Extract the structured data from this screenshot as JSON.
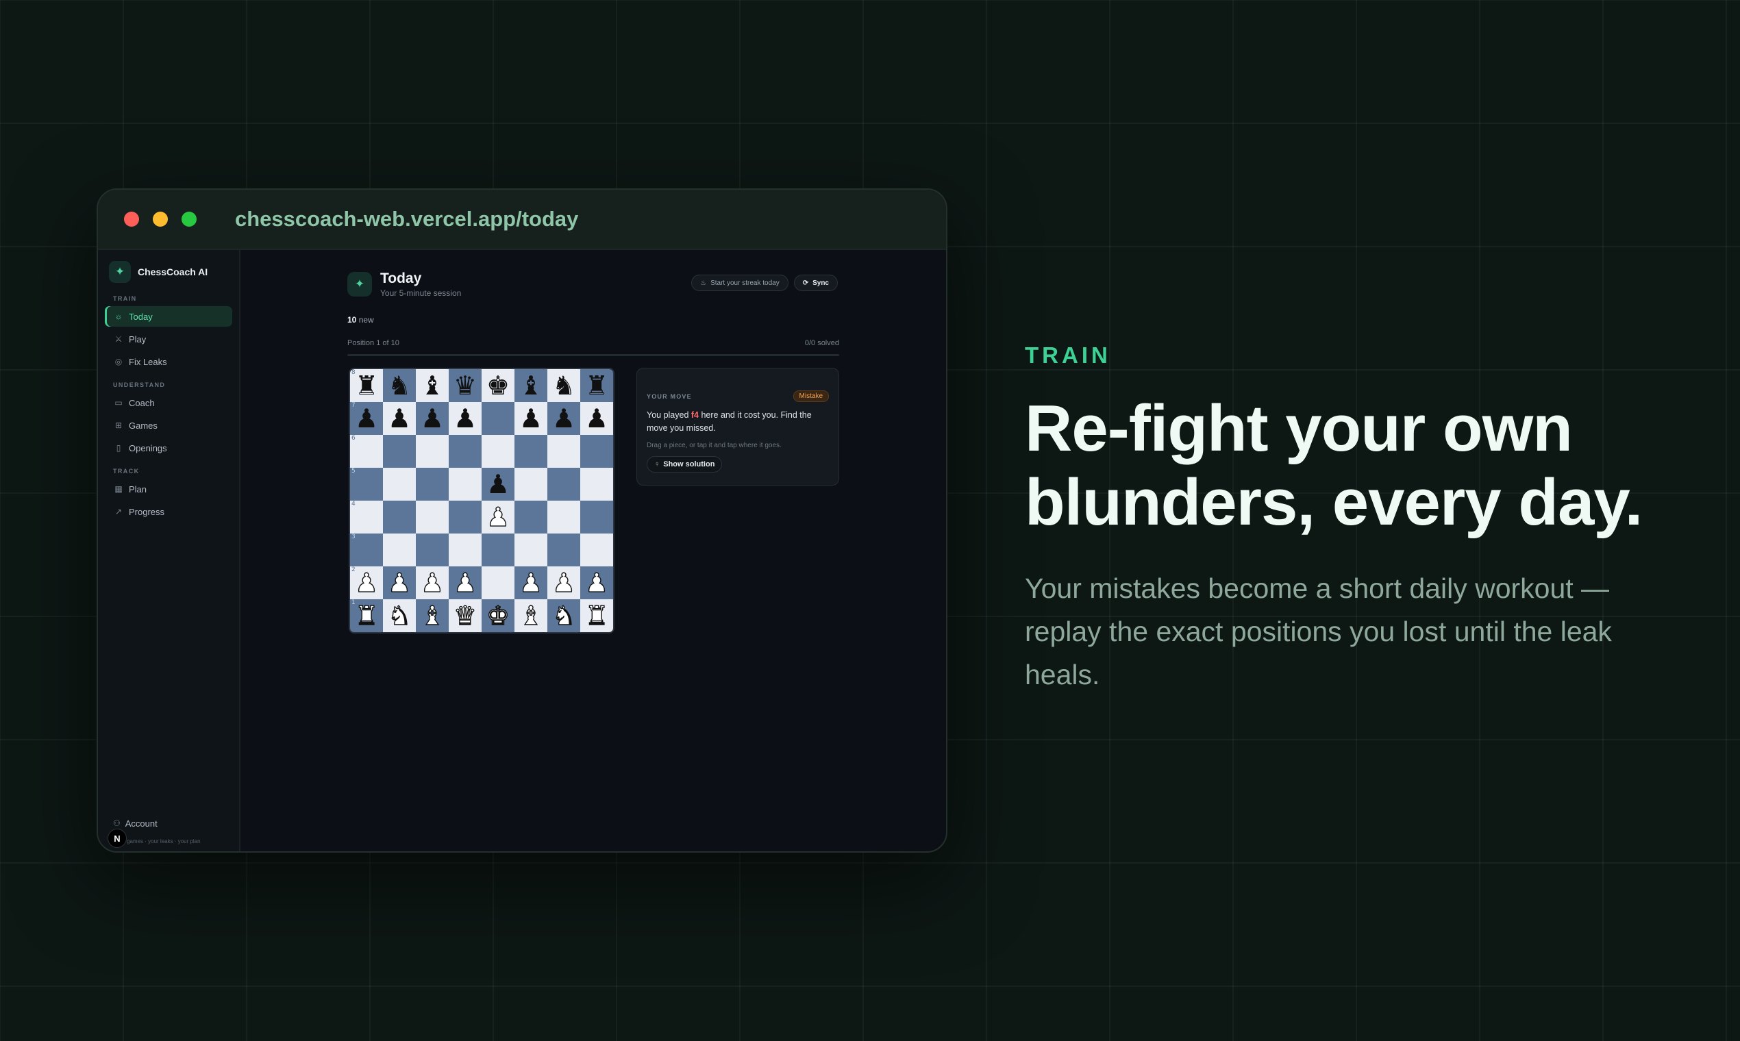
{
  "browser": {
    "url": "chesscoach-web.vercel.app/today"
  },
  "sidebar": {
    "brand": "ChessCoach AI",
    "sections": [
      {
        "label": "TRAIN",
        "items": [
          {
            "label": "Today",
            "icon": "sun-icon",
            "active": true
          },
          {
            "label": "Play",
            "icon": "crossed-swords-icon"
          },
          {
            "label": "Fix Leaks",
            "icon": "target-icon"
          }
        ]
      },
      {
        "label": "UNDERSTAND",
        "items": [
          {
            "label": "Coach",
            "icon": "chat-icon"
          },
          {
            "label": "Games",
            "icon": "grid-icon"
          },
          {
            "label": "Openings",
            "icon": "book-icon"
          }
        ]
      },
      {
        "label": "TRACK",
        "items": [
          {
            "label": "Plan",
            "icon": "calendar-icon"
          },
          {
            "label": "Progress",
            "icon": "trend-icon"
          }
        ]
      }
    ],
    "account_label": "Account",
    "tagline": "games · your leaks · your plan",
    "badge": "N"
  },
  "page": {
    "title": "Today",
    "subtitle": "Your 5-minute session",
    "streak_button": "Start your streak today",
    "sync_button": "Sync",
    "new_count": "10",
    "new_label": "new",
    "position_label": "Position 1 of 10",
    "solved_label": "0/0 solved",
    "progress_fraction": 0.0
  },
  "board": {
    "ranks": [
      [
        "r",
        "n",
        "b",
        "q",
        "k",
        "b",
        "n",
        "r"
      ],
      [
        "p",
        "p",
        "p",
        "p",
        "",
        "p",
        "p",
        "p"
      ],
      [
        "",
        "",
        "",
        "",
        "",
        "",
        "",
        ""
      ],
      [
        "",
        "",
        "",
        "",
        "p",
        "",
        "",
        ""
      ],
      [
        "",
        "",
        "",
        "",
        "P",
        "",
        "",
        ""
      ],
      [
        "",
        "",
        "",
        "",
        "",
        "",
        "",
        ""
      ],
      [
        "P",
        "P",
        "P",
        "P",
        "",
        "P",
        "P",
        "P"
      ],
      [
        "R",
        "N",
        "B",
        "Q",
        "K",
        "B",
        "N",
        "R"
      ]
    ],
    "rank_labels": [
      "8",
      "7",
      "6",
      "5",
      "4",
      "3",
      "2",
      "1"
    ]
  },
  "move_card": {
    "label": "YOUR MOVE",
    "badge": "Mistake",
    "text_before": "You played ",
    "move": "f4",
    "text_after": " here and it cost you. Find the move you missed.",
    "hint": "Drag a piece, or tap it and tap where it goes.",
    "solution_button": "Show solution"
  },
  "marketing": {
    "eyebrow": "TRAIN",
    "headline": "Re-fight your own blunders, every day.",
    "body": "Your mistakes become a short daily workout — replay the exact positions you lost until the leak heals."
  },
  "colors": {
    "accent": "#3ed196",
    "board_light": "#e9edf3",
    "board_dark": "#5b7699",
    "mistake": "#f0a050"
  }
}
